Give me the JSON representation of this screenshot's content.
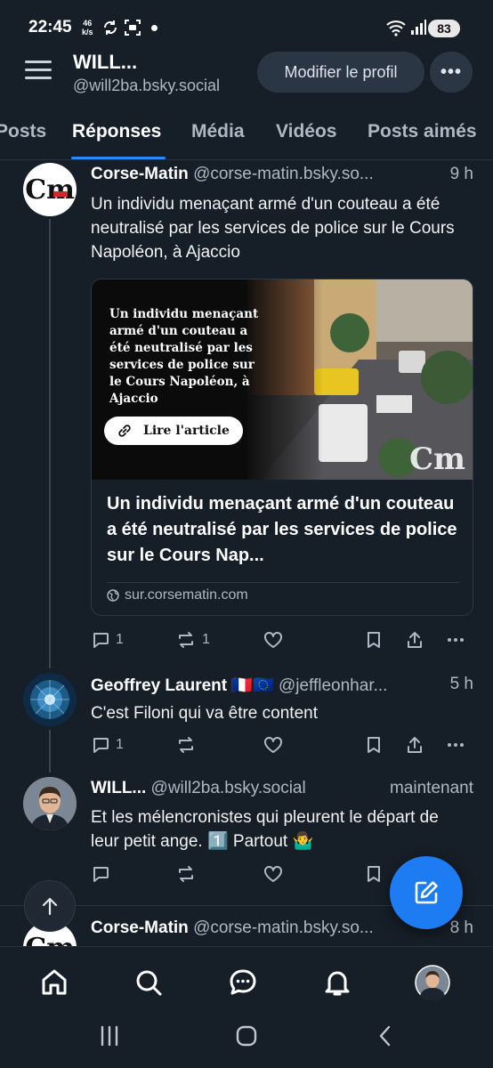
{
  "status_bar": {
    "time": "22:45",
    "net_speed_value": "46",
    "net_speed_unit": "k/s",
    "battery": "83"
  },
  "header": {
    "name": "WILL...",
    "handle": "@will2ba.bsky.social",
    "edit_profile_label": "Modifier le profil",
    "more_label": "•••"
  },
  "tabs": [
    {
      "label": "Posts"
    },
    {
      "label": "Réponses",
      "active": true
    },
    {
      "label": "Média"
    },
    {
      "label": "Vidéos"
    },
    {
      "label": "Posts aimés"
    }
  ],
  "posts": [
    {
      "author": "Corse-Matin",
      "handle": "@corse-matin.bsky.so...",
      "time": "9 h",
      "text": "Un individu menaçant armé d'un couteau a été neutralisé par les services de police sur le Cours Napoléon, à Ajaccio",
      "link_card": {
        "image_text": "Un individu menaçant armé d'un couteau a été neutralisé par les services de police sur le Cours Napoléon, à Ajaccio",
        "image_button": "Lire l'article",
        "image_logo": "Cm",
        "title": "Un individu menaçant armé d'un couteau a été neutralisé par les services de police sur le Cours Nap...",
        "domain": "sur.corsematin.com"
      },
      "replies": "1",
      "reposts": "1",
      "avatar_logo": "Cm"
    },
    {
      "author": "Geoffrey Laurent 🇫🇷🇪🇺",
      "handle": "@jeffleonhar...",
      "time": "5 h",
      "text": "C'est Filoni qui va être content",
      "replies": "1",
      "reposts": ""
    },
    {
      "author": "WILL...",
      "handle": "@will2ba.bsky.social",
      "time": "maintenant",
      "text": "Et les mélencronistes qui pleurent le départ de leur petit ange. 1️⃣ Partout 🤷‍♂️",
      "replies": "",
      "reposts": ""
    },
    {
      "author": "Corse-Matin",
      "handle": "@corse-matin.bsky.so...",
      "time": "8 h",
      "avatar_logo": "Cm"
    }
  ],
  "colors": {
    "background": "#161e27",
    "accent": "#2f86f6",
    "fab": "#1e7cf2",
    "muted_text": "#aeb8c4"
  }
}
